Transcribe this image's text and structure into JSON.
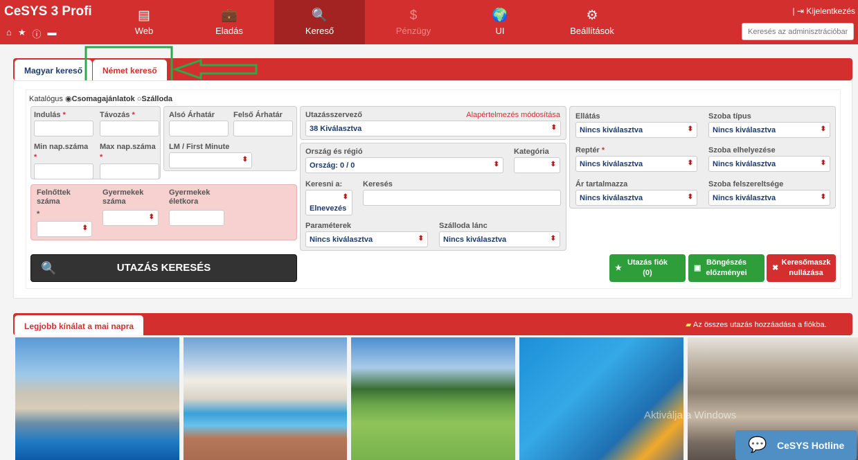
{
  "app": {
    "brand": "CeSYS 3 Profi",
    "brand_icons": [
      "home-icon",
      "star-icon",
      "info-icon",
      "chat-icon"
    ]
  },
  "nav": {
    "items": [
      {
        "label": "Web",
        "icon": "▤",
        "icon_name": "web-icon"
      },
      {
        "label": "Eladás",
        "icon": "💼",
        "icon_name": "briefcase-icon"
      },
      {
        "label": "Kereső",
        "icon": "🔍",
        "icon_name": "search-icon"
      },
      {
        "label": "Pénzügy",
        "icon": "$",
        "icon_name": "dollar-icon"
      },
      {
        "label": "UI",
        "icon": "🌍",
        "icon_name": "globe-icon"
      },
      {
        "label": "Beállítások",
        "icon": "⚙",
        "icon_name": "gear-icon"
      }
    ],
    "logout": "Kijelentkezés",
    "admin_search_placeholder": "Keresés az adminisztrációban"
  },
  "tabs": {
    "magyar": "Magyar kereső",
    "nemet": "Német kereső"
  },
  "catalog": {
    "label": "Katalógus",
    "option1": "Csomagajánlatok",
    "option2": "Szálloda"
  },
  "dates": {
    "indulas": "Indulás",
    "tavozas": "Távozás",
    "min_nap": "Min nap.száma",
    "max_nap": "Max nap.száma"
  },
  "price": {
    "also": "Alsó Árhatár",
    "felso": "Felső Árhatár",
    "lm": "LM / First Minute"
  },
  "persons": {
    "felnott": "Felnőttek száma",
    "gyermekek": "Gyermekek száma",
    "eletkora": "Gyermekek életkora"
  },
  "organizer": {
    "label": "Utazásszervező",
    "default_link": "Alapértelmezés módosítása",
    "value": "38 Kiválasztva"
  },
  "region": {
    "label": "Ország és régió",
    "value": "Ország: 0 / 0",
    "kategoria": "Kategória",
    "keresni_a": "Keresni a:",
    "keresni_value": "Elnevezés",
    "kereses": "Keresés",
    "parameterek": "Paraméterek",
    "parameterek_value": "Nincs kiválasztva",
    "lanc": "Szálloda lánc",
    "lanc_value": "Nincs kiválasztva"
  },
  "right": {
    "ellatas": "Ellátás",
    "szobatipus": "Szoba típus",
    "repter": "Reptér",
    "elhelyezes": "Szoba elhelyezése",
    "ar_tartalmazza": "Ár tartalmazza",
    "felszereltseg": "Szoba felszereltsége",
    "none": "Nincs kiválasztva"
  },
  "buttons": {
    "search": "UTAZÁS KERESÉS",
    "fiok_line1": "Utazás fiók",
    "fiok_line2": "(0)",
    "bong_line1": "Böngészés",
    "bong_line2": "előzményei",
    "null_line1": "Keresőmaszk",
    "null_line2": "nullázása"
  },
  "best": {
    "title": "Legjobb kínálat a mai napra",
    "add_all": "Az összes utazás hozzáadása a fiókba."
  },
  "hotline": "CeSYS Hotline",
  "watermark": "Aktiválja a Windows",
  "colors": {
    "brand_red": "#d32f2f",
    "active_nav": "#a32323",
    "green": "#2e9e3a",
    "dark": "#333333"
  }
}
